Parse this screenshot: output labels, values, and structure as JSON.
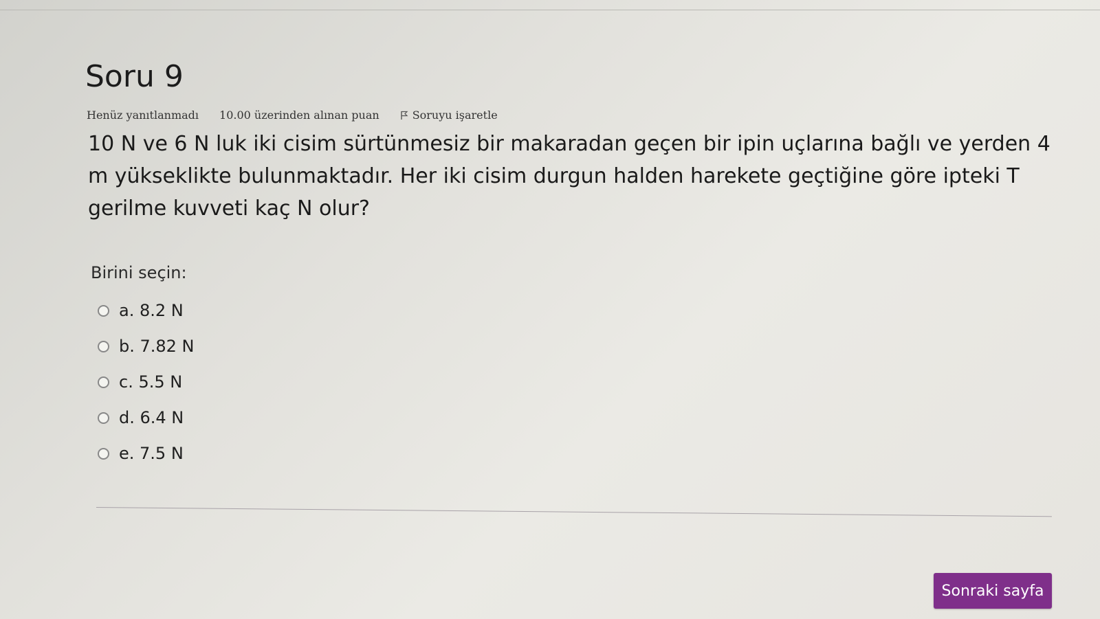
{
  "question": {
    "title": "Soru 9",
    "state": "Henüz yanıtlanmadı",
    "grade": "10.00 üzerinden alınan puan",
    "flag_label": "Soruyu işaretle",
    "text": "10 N ve 6 N luk iki cisim sürtünmesiz bir makaradan geçen bir ipin uçlarına bağlı ve yerden 4 m yükseklikte bulunmaktadır. Her iki cisim durgun halden harekete geçtiğine göre ipteki T gerilme kuvveti kaç N olur?",
    "prompt": "Birini seçin:",
    "answers": [
      {
        "label": "a. 8.2 N"
      },
      {
        "label": "b. 7.82 N"
      },
      {
        "label": "c. 5.5 N"
      },
      {
        "label": "d. 6.4 N"
      },
      {
        "label": "e. 7.5 N"
      }
    ]
  },
  "navigation": {
    "next_label": "Sonraki sayfa"
  },
  "colors": {
    "accent": "#7f2f8a",
    "background": "#e4e3de"
  },
  "icons": {
    "flag": "flag-icon",
    "radio": "radio-unchecked-icon"
  }
}
